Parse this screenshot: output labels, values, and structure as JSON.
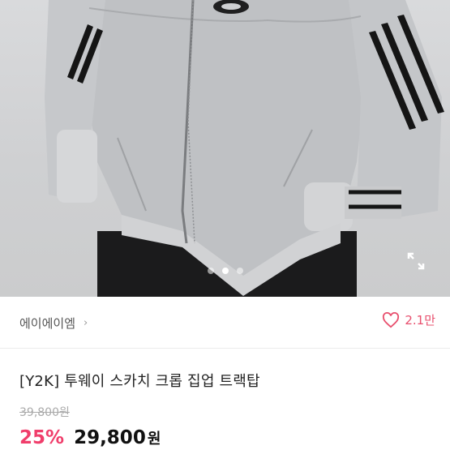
{
  "product_image": {
    "alt_icon": "jacket-photo",
    "carousel": {
      "total": 3,
      "active_index": 1
    },
    "expand_icon": "expand-icon"
  },
  "seller": {
    "name": "에이에이엠",
    "chevron": "›"
  },
  "likes": {
    "icon": "heart-icon",
    "count": "2.1만",
    "color": "#e8506e"
  },
  "product": {
    "title": "[Y2K] 투웨이 스카치 크롭 집업 트랙탑",
    "original_price": "39,800원",
    "discount": "25%",
    "price": "29,800",
    "currency": "원"
  },
  "colors": {
    "discount": "#f03e6b",
    "price": "#111111"
  }
}
